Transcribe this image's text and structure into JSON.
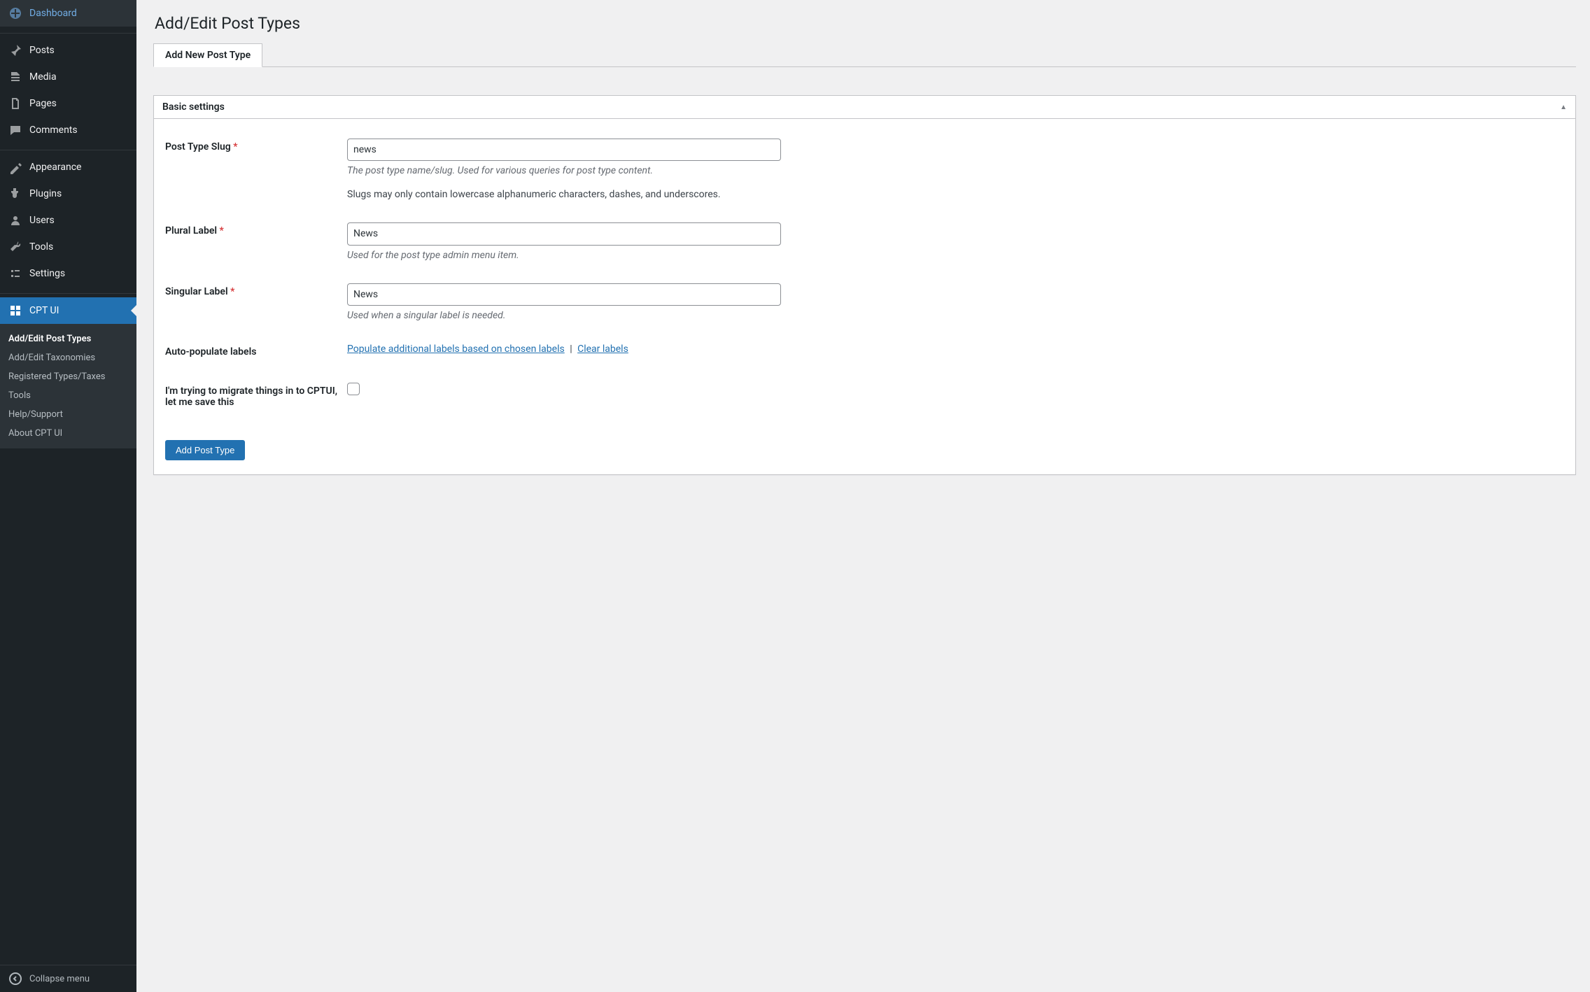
{
  "sidebar": {
    "items": [
      {
        "label": "Dashboard",
        "icon": "dashboard"
      },
      {
        "label": "Posts",
        "icon": "pin"
      },
      {
        "label": "Media",
        "icon": "media"
      },
      {
        "label": "Pages",
        "icon": "pages"
      },
      {
        "label": "Comments",
        "icon": "comments"
      },
      {
        "label": "Appearance",
        "icon": "appearance"
      },
      {
        "label": "Plugins",
        "icon": "plugins"
      },
      {
        "label": "Users",
        "icon": "users"
      },
      {
        "label": "Tools",
        "icon": "tools"
      },
      {
        "label": "Settings",
        "icon": "settings"
      },
      {
        "label": "CPT UI",
        "icon": "cptui"
      }
    ],
    "submenu": [
      "Add/Edit Post Types",
      "Add/Edit Taxonomies",
      "Registered Types/Taxes",
      "Tools",
      "Help/Support",
      "About CPT UI"
    ],
    "collapse_label": "Collapse menu"
  },
  "page": {
    "title": "Add/Edit Post Types",
    "tab": "Add New Post Type",
    "panel_title": "Basic settings",
    "fields": {
      "slug": {
        "label": "Post Type Slug",
        "value": "news",
        "desc": "The post type name/slug. Used for various queries for post type content.",
        "note": "Slugs may only contain lowercase alphanumeric characters, dashes, and underscores."
      },
      "plural": {
        "label": "Plural Label",
        "value": "News",
        "desc": "Used for the post type admin menu item."
      },
      "singular": {
        "label": "Singular Label",
        "value": "News",
        "desc": "Used when a singular label is needed."
      },
      "auto": {
        "label": "Auto-populate labels",
        "link_populate": "Populate additional labels based on chosen labels",
        "link_clear": "Clear labels"
      },
      "migrate": {
        "label": "I'm trying to migrate things in to CPTUI, let me save this"
      }
    },
    "submit_label": "Add Post Type"
  }
}
